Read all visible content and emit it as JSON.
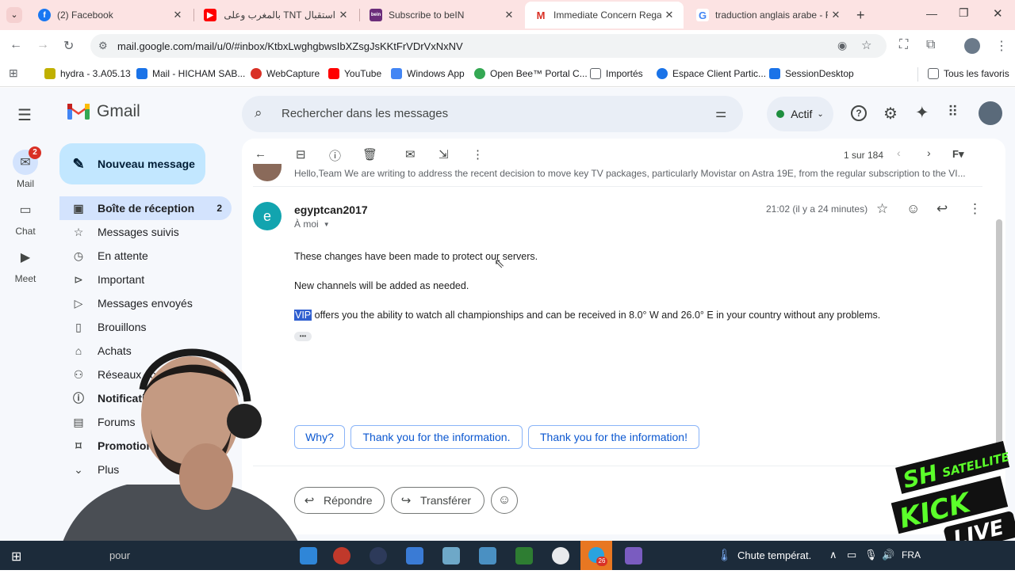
{
  "tabs": [
    {
      "label": "(2) Facebook",
      "close": "✕",
      "icon": "facebook-icon"
    },
    {
      "label": "استقبال TNT بالمغرب وعلى ال",
      "close": "✕",
      "icon": "youtube-icon"
    },
    {
      "label": "Subscribe to beIN",
      "close": "✕",
      "icon": "bein-icon"
    },
    {
      "label": "Immediate Concern Regardi",
      "close": "✕",
      "icon": "gmail-icon"
    },
    {
      "label": "traduction anglais arabe - R",
      "close": "✕",
      "icon": "google-icon"
    }
  ],
  "url": "mail.google.com/mail/u/0/#inbox/KtbxLwghgbwsIbXZsgJsKKtFrVDrVxNxNV",
  "bookmarks": [
    {
      "label": "hydra - 3.A05.13",
      "color": "#c0b000"
    },
    {
      "label": "Mail - HICHAM SAB...",
      "color": "#1a73e8"
    },
    {
      "label": "WebCapture",
      "color": "#d93025"
    },
    {
      "label": "YouTube",
      "color": "#ff0000"
    },
    {
      "label": "Windows App",
      "color": "#4285f4"
    },
    {
      "label": "Open Bee™ Portal C...",
      "color": "#34a853"
    },
    {
      "label": "Importés",
      "color": "#5f6368"
    },
    {
      "label": "Espace Client Partic...",
      "color": "#1a73e8"
    },
    {
      "label": "SessionDesktop",
      "color": "#1a73e8"
    },
    {
      "label": "Tous les favoris",
      "color": "#5f6368"
    }
  ],
  "gmail": {
    "brand": "Gmail",
    "search_placeholder": "Rechercher dans les messages",
    "status": "Actif",
    "compose": "Nouveau message",
    "rail": [
      {
        "label": "Mail",
        "badge": "2"
      },
      {
        "label": "Chat"
      },
      {
        "label": "Meet"
      }
    ],
    "nav": [
      {
        "label": "Boîte de réception",
        "count": "2",
        "icon": "inbox-icon",
        "glyph": "▣",
        "active": true
      },
      {
        "label": "Messages suivis",
        "icon": "star-icon",
        "glyph": "☆"
      },
      {
        "label": "En attente",
        "icon": "clock-icon",
        "glyph": "◷"
      },
      {
        "label": "Important",
        "icon": "important-icon",
        "glyph": "⊳"
      },
      {
        "label": "Messages envoyés",
        "icon": "send-icon",
        "glyph": "▷"
      },
      {
        "label": "Brouillons",
        "icon": "draft-icon",
        "glyph": "▯"
      },
      {
        "label": "Achats",
        "icon": "shopping-icon",
        "glyph": "⌂"
      },
      {
        "label": "Réseaux sociaux",
        "icon": "social-icon",
        "glyph": "⚇"
      },
      {
        "label": "Notifications",
        "icon": "info-icon",
        "glyph": "ⓘ",
        "bold": true
      },
      {
        "label": "Forums",
        "icon": "forum-icon",
        "glyph": "▤"
      },
      {
        "label": "Promotions",
        "icon": "tag-icon",
        "glyph": "⌑",
        "bold": true
      },
      {
        "label": "Plus",
        "icon": "chevron-down-icon",
        "glyph": "⌄"
      }
    ],
    "pager": "1 sur 184",
    "preview_text": "Hello,Team We are writing to address the recent decision to move key TV packages, particularly Movistar on Astra 19E, from the regular subscription to the VI...",
    "message": {
      "avatar_letter": "e",
      "sender": "egyptcan2017",
      "to": "À moi",
      "time": "21:02 (il y a 24 minutes)",
      "para1": "These changes have been made to protect our servers.",
      "para2": "New channels will be added as needed.",
      "para3_highlight": "VIP",
      "para3_rest": " offers you the ability to watch all championships and can be received in 8.0° W and 26.0° E in your country without any problems.",
      "ellipsis": "•••"
    },
    "smart_replies": [
      "Why?",
      "Thank you for the information.",
      "Thank you for the information!"
    ],
    "reply": "Répondre",
    "forward": "Transférer"
  },
  "taskbar": {
    "search_fragment": "pour",
    "weather": "Chute températ.",
    "lang": "FRA",
    "telegram_badge": "26"
  },
  "overlay": {
    "logo_top": "SH",
    "logo_sub": "SATELLITE",
    "logo_kick": "KICK",
    "logo_live": "LIVE"
  },
  "colors": {
    "accent": "#0b57d0",
    "avatar": "#12a4af",
    "badge": "#d93025",
    "active_nav": "#d3e3fd",
    "compose": "#c2e7ff"
  }
}
